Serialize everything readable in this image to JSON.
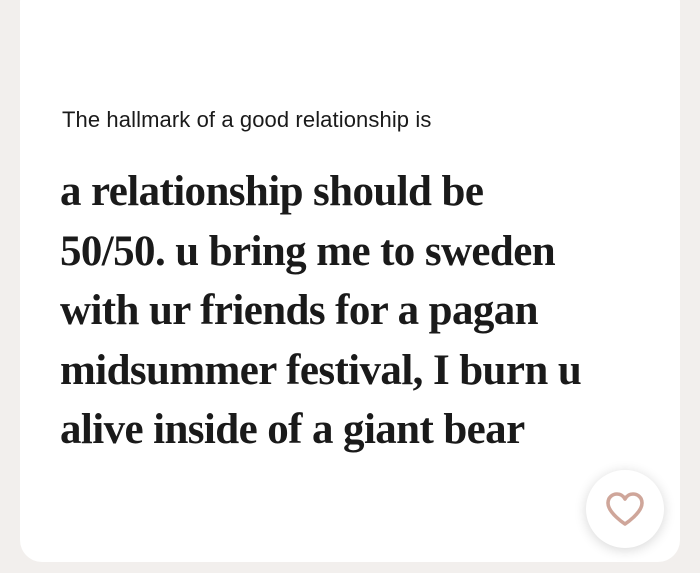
{
  "prompt_card": {
    "prompt": "The hallmark of a good relationship is",
    "answer": "a relationship should be\n50/50. u bring me to sweden\nwith ur friends for a pagan\nmidsummer festival, I burn u\nalive inside of a giant bear"
  },
  "like_button": {
    "icon": "heart-outline-icon",
    "icon_color": "#cfa69a"
  }
}
